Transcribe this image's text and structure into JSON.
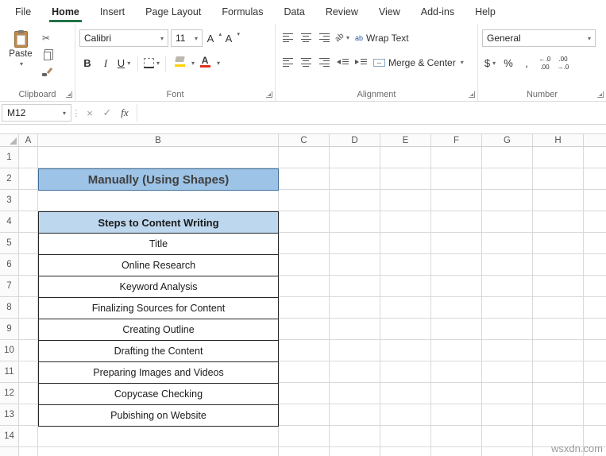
{
  "tabs": [
    "File",
    "Home",
    "Insert",
    "Page Layout",
    "Formulas",
    "Data",
    "Review",
    "View",
    "Add-ins",
    "Help"
  ],
  "active_tab": "Home",
  "ribbon": {
    "clipboard": {
      "label": "Clipboard",
      "paste": "Paste"
    },
    "font": {
      "label": "Font",
      "name": "Calibri",
      "size": "11",
      "bold": "B",
      "italic": "I",
      "underline": "U",
      "grow": "A",
      "shrink": "A",
      "color_letter": "A"
    },
    "alignment": {
      "label": "Alignment",
      "wrap": "Wrap Text",
      "merge": "Merge & Center",
      "ab": "ab"
    },
    "number": {
      "label": "Number",
      "format": "General",
      "currency": "$",
      "percent": "%",
      "comma": ",",
      "increase_decimal": "←.0\n.00",
      "decrease_decimal": ".00\n→.0"
    }
  },
  "formula_bar": {
    "name_box": "M12",
    "fx": "fx",
    "value": ""
  },
  "grid": {
    "columns": [
      "A",
      "B",
      "C",
      "D",
      "E",
      "F",
      "G",
      "H"
    ],
    "rows": [
      "1",
      "2",
      "3",
      "4",
      "5",
      "6",
      "7",
      "8",
      "9",
      "10",
      "11",
      "12",
      "13",
      "14"
    ]
  },
  "sheet": {
    "banner": "Manually (Using Shapes)",
    "table": {
      "header": "Steps to Content Writing",
      "steps": [
        "Title",
        "Online Research",
        "Keyword Analysis",
        "Finalizing Sources for Content",
        "Creating Outline",
        "Drafting the Content",
        "Preparing Images and Videos",
        "Copycase Checking",
        "Pubishing on Website"
      ]
    }
  },
  "watermark": "wsxdn.com",
  "icons": {
    "dropdown": "▾",
    "up": "▴",
    "cut": "✂",
    "check": "✓",
    "cancel": "×",
    "dots": "⋮",
    "merge_arrows": "↔",
    "return_arrow": "↩"
  },
  "colors": {
    "accent_green": "#217346",
    "banner_fill": "#9DC3E6",
    "banner_border": "#41719C",
    "table_header_fill": "#BDD7EE",
    "font_color_bar": "#E0301E",
    "fill_color_bar": "#FFD100"
  }
}
